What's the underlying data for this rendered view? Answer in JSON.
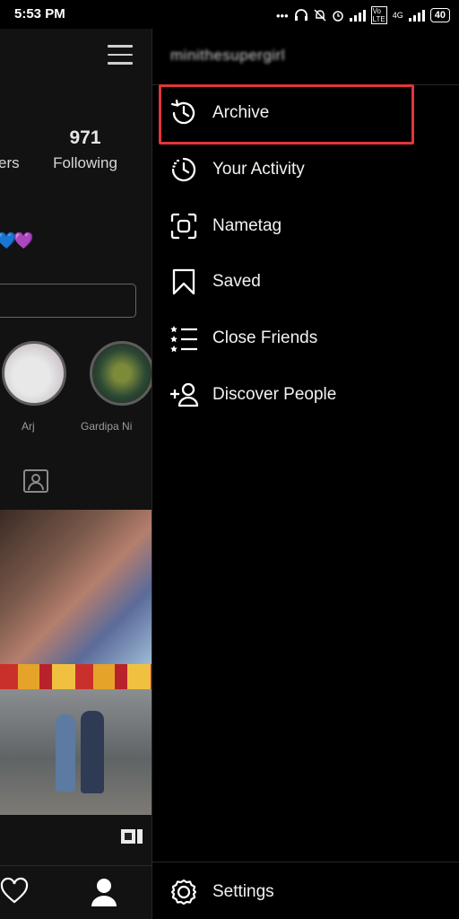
{
  "status_bar": {
    "time": "5:53 PM",
    "network_label": "4G",
    "battery": "40"
  },
  "profile": {
    "following_count": "971",
    "following_label": "Following",
    "followers_label_partial": "ers",
    "hearts": "💙💜",
    "stories": [
      {
        "label": "Arj"
      },
      {
        "label": "Gardipa Ni"
      }
    ]
  },
  "drawer": {
    "username": "minithesupergirl",
    "menu": [
      {
        "label": "Archive",
        "icon": "archive-icon"
      },
      {
        "label": "Your Activity",
        "icon": "activity-icon"
      },
      {
        "label": "Nametag",
        "icon": "nametag-icon"
      },
      {
        "label": "Saved",
        "icon": "bookmark-icon"
      },
      {
        "label": "Close Friends",
        "icon": "close-friends-icon"
      },
      {
        "label": "Discover People",
        "icon": "add-person-icon"
      }
    ],
    "settings_label": "Settings",
    "highlight_color": "#e0363a"
  }
}
